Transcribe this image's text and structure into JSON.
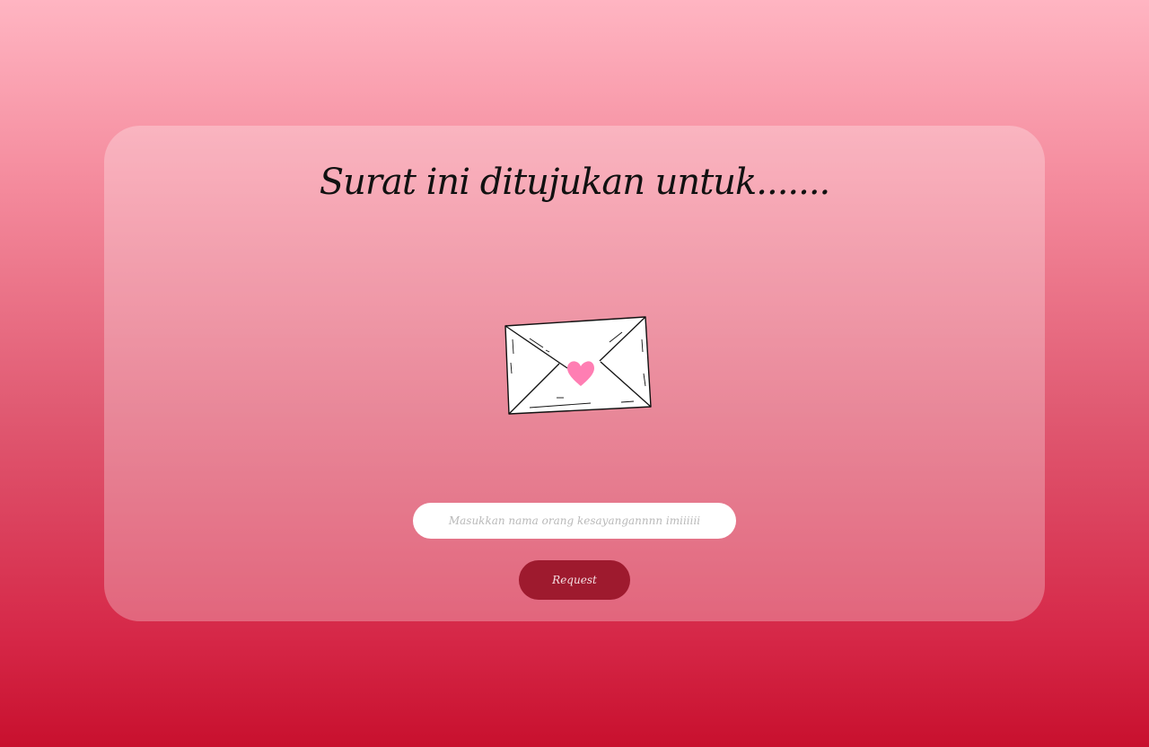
{
  "card": {
    "title": "Surat ini ditujukan untuk.......",
    "illustration": "envelope-heart-icon"
  },
  "form": {
    "name_input": {
      "value": "",
      "placeholder": "Masukkan nama orang kesayangannnn imiiiiii"
    },
    "request_label": "Request"
  },
  "colors": {
    "background_top": "#ffb5c2",
    "background_bottom": "#c8102e",
    "button": "#9e1a2e",
    "heart": "#ff7eb3"
  }
}
